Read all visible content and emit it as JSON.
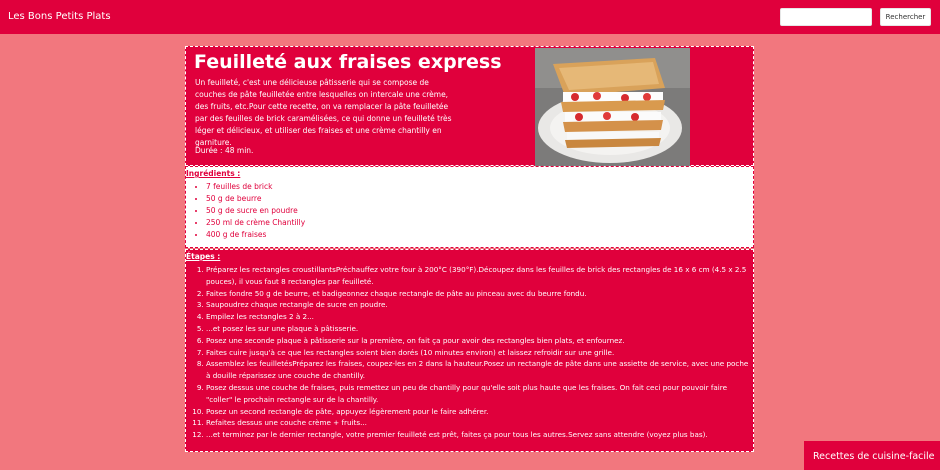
{
  "header": {
    "brand": "Les Bons Petits Plats",
    "search_placeholder": "",
    "search_button": "Rechercher"
  },
  "recipe": {
    "title": "Feuilleté aux fraises express",
    "description": "Un feuilleté, c'est une délicieuse pâtisserie qui se compose de couches de pâte feuilletée entre lesquelles on intercale une crème, des fruits, etc.Pour cette recette, on va remplacer la pâte feuilletée par des feuilles de brick caramélisées, ce qui donne un feuilleté très léger et délicieux, et utiliser des fraises et une crème chantilly en garniture.",
    "duration": "Durée : 48 min.",
    "image_alt": "feuilleté aux fraises"
  },
  "ingredients": {
    "label": "Ingrédients :",
    "items": [
      "7 feuilles de brick",
      "50 g de beurre",
      "50 g de sucre en poudre",
      "250 ml de crème Chantilly",
      "400 g de fraises"
    ]
  },
  "steps": {
    "label": "Étapes :",
    "items": [
      "Préparez les rectangles croustillantsPréchauffez votre four à 200°C (390°F).Découpez dans les feuilles de brick des rectangles de 16 x 6 cm (4.5 x 2.5 pouces), il vous faut 8 rectangles par feuilleté.",
      "Faites fondre 50 g de beurre, et badigeonnez chaque rectangle de pâte au pinceau avec du beurre fondu.",
      "Saupoudrez chaque rectangle de sucre en poudre.",
      "Empilez les rectangles 2 à 2...",
      "...et posez les sur une plaque à pâtisserie.",
      "Posez une seconde plaque à pâtisserie sur la première, on fait ça pour avoir des rectangles bien plats, et enfournez.",
      "Faites cuire jusqu'à ce que les rectangles soient bien dorés (10 minutes environ) et laissez refroidir sur une grille.",
      "Assemblez les feuilletésPréparez les fraises, coupez-les en 2 dans la hauteur.Posez un rectangle de pâte dans une assiette de service, avec une poche à douille réparissez une couche de chantilly.",
      "Posez dessus une couche de fraises, puis remettez un peu de chantilly pour qu'elle soit plus haute que les fraises. On fait ceci pour pouvoir faire \"coller\" le prochain rectangle sur de la chantilly.",
      "Posez un second rectangle de pâte, appuyez légèrement pour le faire adhérer.",
      "Refaites dessus une couche crème + fruits...",
      "...et terminez par le dernier rectangle, votre premier feuilleté est prêt, faites ça pour tous les autres.Servez sans attendre (voyez plus bas)."
    ]
  },
  "footer": {
    "tag": "Recettes de cuisine-facile"
  },
  "colors": {
    "accent": "#e0003c",
    "background": "#f2777e",
    "white": "#ffffff"
  }
}
